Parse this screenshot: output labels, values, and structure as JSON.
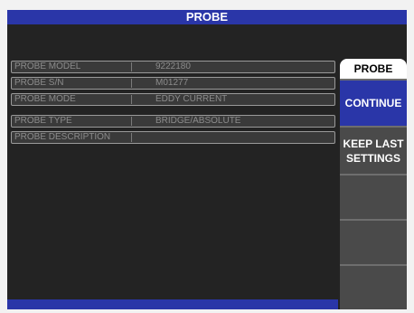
{
  "title": "PROBE",
  "probe_fields": [
    {
      "label": "PROBE MODEL",
      "value": "9222180"
    },
    {
      "label": "PROBE S/N",
      "value": "M01277"
    },
    {
      "label": "PROBE MODE",
      "value": "EDDY CURRENT"
    },
    {
      "label": "PROBE TYPE",
      "value": "BRIDGE/ABSOLUTE"
    },
    {
      "label": "PROBE DESCRIPTION",
      "value": ""
    }
  ],
  "softkeys": {
    "header": "PROBE",
    "continue": "CONTINUE",
    "keep_last_line1": "KEEP LAST",
    "keep_last_line2": "SETTINGS",
    "empty1": "",
    "empty2": "",
    "empty3": ""
  },
  "colors": {
    "accent": "#2a36a8",
    "screen": "#232323",
    "button": "#4a4a4a"
  }
}
